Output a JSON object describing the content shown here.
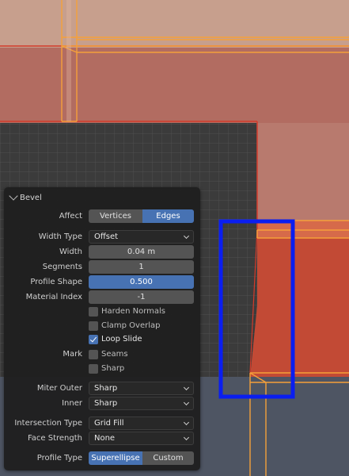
{
  "panel": {
    "title": "Bevel",
    "affect": {
      "label": "Affect",
      "options": [
        "Vertices",
        "Edges"
      ],
      "selected": "Edges"
    },
    "width_type": {
      "label": "Width Type",
      "value": "Offset"
    },
    "width": {
      "label": "Width",
      "value": "0.04 m"
    },
    "segments": {
      "label": "Segments",
      "value": "1"
    },
    "profile_shape": {
      "label": "Profile Shape",
      "value": "0.500"
    },
    "material_index": {
      "label": "Material Index",
      "value": "-1"
    },
    "harden_normals": {
      "label": "Harden Normals",
      "checked": false
    },
    "clamp_overlap": {
      "label": "Clamp Overlap",
      "checked": false
    },
    "loop_slide": {
      "label": "Loop Slide",
      "checked": true
    },
    "mark": {
      "label": "Mark",
      "seams": {
        "label": "Seams",
        "checked": false
      },
      "sharp": {
        "label": "Sharp",
        "checked": false
      }
    },
    "miter_outer": {
      "label": "Miter Outer",
      "value": "Sharp"
    },
    "inner": {
      "label": "Inner",
      "value": "Sharp"
    },
    "intersection_type": {
      "label": "Intersection Type",
      "value": "Grid Fill"
    },
    "face_strength": {
      "label": "Face Strength",
      "value": "None"
    },
    "profile_type": {
      "label": "Profile Type",
      "options": [
        "Superellipse",
        "Custom"
      ],
      "selected": "Superellipse"
    }
  },
  "colors": {
    "selection_orange": "#f5a03a",
    "active_blue": "#4772b3",
    "highlight_box": "#0a1ef0",
    "face_red": "#c24a35"
  }
}
